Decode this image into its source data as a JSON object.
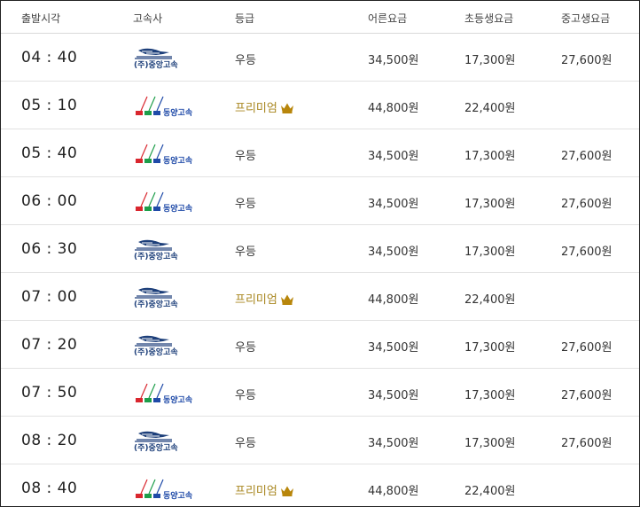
{
  "headers": [
    "출발시각",
    "고속사",
    "등급",
    "어른요금",
    "초등생요금",
    "중고생요금"
  ],
  "rows": [
    {
      "time": "04 : 40",
      "company": "(주)중앙고속",
      "grade": "우등",
      "premium": false,
      "adult": "34,500원",
      "child": "17,300원",
      "youth": "27,600원"
    },
    {
      "time": "05 : 10",
      "company": "동양고속",
      "grade": "프리미엄",
      "premium": true,
      "adult": "44,800원",
      "child": "22,400원",
      "youth": ""
    },
    {
      "time": "05 : 40",
      "company": "동양고속",
      "grade": "우등",
      "premium": false,
      "adult": "34,500원",
      "child": "17,300원",
      "youth": "27,600원"
    },
    {
      "time": "06 : 00",
      "company": "동양고속",
      "grade": "우등",
      "premium": false,
      "adult": "34,500원",
      "child": "17,300원",
      "youth": "27,600원"
    },
    {
      "time": "06 : 30",
      "company": "(주)중앙고속",
      "grade": "우등",
      "premium": false,
      "adult": "34,500원",
      "child": "17,300원",
      "youth": "27,600원"
    },
    {
      "time": "07 : 00",
      "company": "(주)중앙고속",
      "grade": "프리미엄",
      "premium": true,
      "adult": "44,800원",
      "child": "22,400원",
      "youth": ""
    },
    {
      "time": "07 : 20",
      "company": "(주)중앙고속",
      "grade": "우등",
      "premium": false,
      "adult": "34,500원",
      "child": "17,300원",
      "youth": "27,600원"
    },
    {
      "time": "07 : 50",
      "company": "동양고속",
      "grade": "우등",
      "premium": false,
      "adult": "34,500원",
      "child": "17,300원",
      "youth": "27,600원"
    },
    {
      "time": "08 : 20",
      "company": "(주)중앙고속",
      "grade": "우등",
      "premium": false,
      "adult": "34,500원",
      "child": "17,300원",
      "youth": "27,600원"
    },
    {
      "time": "08 : 40",
      "company": "동양고속",
      "grade": "프리미엄",
      "premium": true,
      "adult": "44,800원",
      "child": "22,400원",
      "youth": ""
    }
  ],
  "colors": {
    "premium": "#a8861f",
    "crown": "#b8860b",
    "dongyang_red": "#d9262e",
    "dongyang_green": "#1e9e4a",
    "dongyang_blue": "#1f4aa8",
    "jungang_navy": "#1d3f7a"
  },
  "icons": {
    "premium": "crown-icon",
    "jungang": "jungang-logo",
    "dongyang": "dongyang-logo"
  }
}
